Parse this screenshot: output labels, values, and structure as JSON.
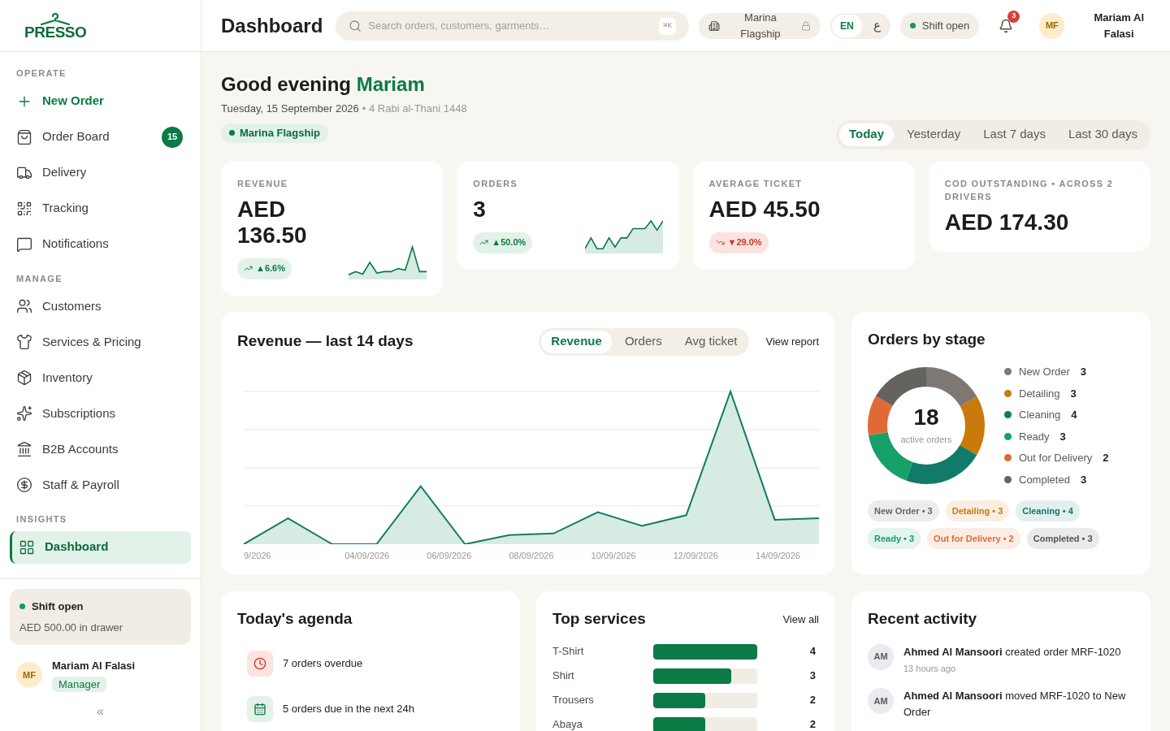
{
  "brand": {
    "name": "PRESSO"
  },
  "sidebar": {
    "sections": [
      {
        "title": "OPERATE",
        "items": [
          {
            "label": "New Order",
            "kind": "action",
            "selected": false
          },
          {
            "label": "Order Board",
            "kind": "link",
            "selected": false,
            "badge": "15"
          },
          {
            "label": "Delivery",
            "kind": "link",
            "selected": false
          },
          {
            "label": "Tracking",
            "kind": "link",
            "selected": false
          },
          {
            "label": "Notifications",
            "kind": "link",
            "selected": false
          }
        ]
      },
      {
        "title": "MANAGE",
        "items": [
          {
            "label": "Customers",
            "kind": "link",
            "selected": false
          },
          {
            "label": "Services & Pricing",
            "kind": "link",
            "selected": false
          },
          {
            "label": "Inventory",
            "kind": "link",
            "selected": false
          },
          {
            "label": "Subscriptions",
            "kind": "link",
            "selected": false
          },
          {
            "label": "B2B Accounts",
            "kind": "link",
            "selected": false
          },
          {
            "label": "Staff & Payroll",
            "kind": "link",
            "selected": false
          }
        ]
      },
      {
        "title": "INSIGHTS",
        "items": [
          {
            "label": "Dashboard",
            "kind": "link",
            "selected": true
          }
        ]
      }
    ],
    "shift": {
      "title": "Shift open",
      "on": true,
      "detail": "AED 500.00 in drawer"
    },
    "user": {
      "initials": "MF",
      "name": "Mariam Al Falasi",
      "role": "Manager"
    },
    "collapse": "«"
  },
  "header": {
    "title": "Dashboard",
    "search": {
      "placeholder": "Search orders, customers, garments…",
      "shortcut": "⌘K"
    },
    "branch": "Marina Flagship",
    "languages": [
      {
        "label": "EN",
        "selected": true
      },
      {
        "label": "ع",
        "selected": false
      }
    ],
    "shift": {
      "label": "Shift open",
      "on": true
    },
    "notifications": "3",
    "user": {
      "initials": "MF",
      "name": "Mariam Al Falasi"
    }
  },
  "greeting": {
    "text": "Good evening",
    "name": "Mariam",
    "date": "Tuesday, 15 September 2026",
    "hijri": "• 4 Rabi al-Thani 1448",
    "branch": "Marina Flagship"
  },
  "ranges": [
    {
      "label": "Today",
      "selected": true
    },
    {
      "label": "Yesterday",
      "selected": false
    },
    {
      "label": "Last 7 days",
      "selected": false
    },
    {
      "label": "Last 30 days",
      "selected": false
    }
  ],
  "kpis": [
    {
      "label": "REVENUE",
      "value": "AED 136.50",
      "delta": {
        "text": "▲6.6%",
        "kind": "increase"
      },
      "kind": "sparkline"
    },
    {
      "label": "ORDERS",
      "value": "3",
      "delta": {
        "text": "▲50.0%",
        "kind": "increase"
      },
      "kind": "sparkline"
    },
    {
      "label": "AVERAGE TICKET",
      "value": "AED 45.50",
      "delta": {
        "text": "▼29.0%",
        "kind": "decrease"
      },
      "kind": "plain"
    },
    {
      "label": "COD OUTSTANDING • ACROSS 2 DRIVERS",
      "value": "AED 174.30",
      "kind": "plain"
    }
  ],
  "revenue_chart": {
    "title": "Revenue — last 14 days",
    "tabs": [
      {
        "label": "Revenue",
        "selected": true
      },
      {
        "label": "Orders",
        "selected": false
      },
      {
        "label": "Avg ticket",
        "selected": false
      }
    ],
    "link": "View report",
    "x_labels": [
      "9/2026",
      "04/09/2026",
      "06/09/2026",
      "08/09/2026",
      "10/09/2026",
      "12/09/2026",
      "14/09/2026"
    ]
  },
  "stages": {
    "title": "Orders by stage",
    "total": "18",
    "total_label": "active orders",
    "items": [
      {
        "label": "New Order",
        "count": "3",
        "color": "#7d7873"
      },
      {
        "label": "Detailing",
        "count": "3",
        "color": "#c97a0a"
      },
      {
        "label": "Cleaning",
        "count": "4",
        "color": "#127a68"
      },
      {
        "label": "Ready",
        "count": "3",
        "color": "#16a06a"
      },
      {
        "label": "Out for Delivery",
        "count": "2",
        "color": "#e06a35"
      },
      {
        "label": "Completed",
        "count": "3",
        "color": "#65635e"
      }
    ],
    "chips": [
      {
        "label": "New Order • 3",
        "color": "#6b6660"
      },
      {
        "label": "Detailing • 3",
        "color": "#c97a0a"
      },
      {
        "label": "Cleaning • 4",
        "color": "#127a68"
      },
      {
        "label": "Ready • 3",
        "color": "#16a06a"
      },
      {
        "label": "Out for Delivery • 2",
        "color": "#e06a35"
      },
      {
        "label": "Completed • 3",
        "color": "#55534e"
      }
    ]
  },
  "agenda": {
    "title": "Today's agenda",
    "items": [
      {
        "text": "7 orders overdue",
        "kind": "overdue"
      },
      {
        "text": "5 orders due in the next 24h",
        "kind": "due"
      }
    ]
  },
  "top_services": {
    "title": "Top services",
    "link": "View all",
    "items": [
      {
        "name": "T-Shirt",
        "count": "4",
        "level": 1
      },
      {
        "name": "Shirt",
        "count": "3",
        "level": 0.75
      },
      {
        "name": "Trousers",
        "count": "2",
        "level": 0.5
      },
      {
        "name": "Abaya",
        "count": "2",
        "level": 0.5
      }
    ]
  },
  "activity": {
    "title": "Recent activity",
    "items": [
      {
        "initials": "AM",
        "text": "**Ahmed Al Mansoori** created order MRF-1020",
        "time": "13 hours ago"
      },
      {
        "initials": "AM",
        "text": "**Ahmed Al Mansoori** moved MRF-1020 to New Order"
      }
    ]
  }
}
